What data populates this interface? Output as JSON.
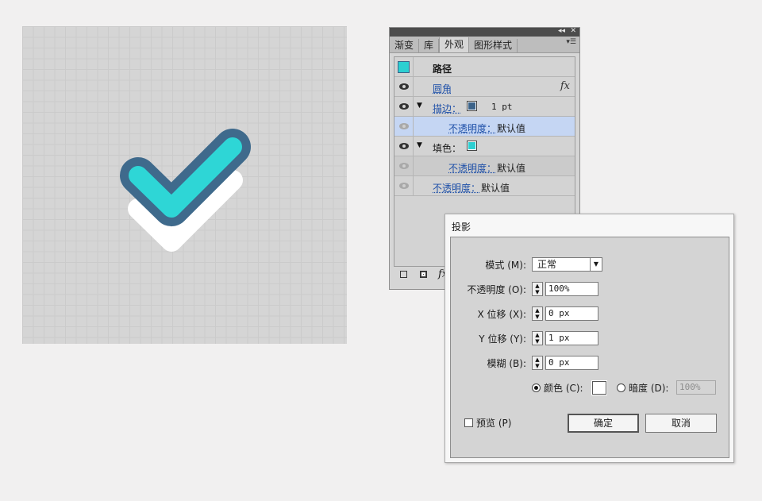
{
  "colors": {
    "check_fill": "#2ed6d6",
    "check_stroke": "#3f6a8c",
    "stroke_swatch": "#3c6389",
    "fill_swatch": "#2ccfd1"
  },
  "panel": {
    "tabs": [
      "渐变",
      "库",
      "外观",
      "图形样式"
    ],
    "active_tab": "外观",
    "header": "路径",
    "rows": {
      "effect": "圆角",
      "stroke_label": "描边：",
      "stroke_value": "1 pt",
      "stroke_opacity_label": "不透明度：",
      "stroke_opacity_value": "默认值",
      "fill_label": "填色：",
      "fill_opacity_label": "不透明度：",
      "fill_opacity_value": "默认值",
      "opacity_label": "不透明度：",
      "opacity_value": "默认值"
    },
    "fx_glyph": "fx",
    "collapse_glyph": "◂◂",
    "close_glyph": "✕",
    "menu_glyph": "▾☰"
  },
  "dialog": {
    "title": "投影",
    "mode_label": "模式 (M):",
    "mode_value": "正常",
    "opacity_label": "不透明度 (O):",
    "opacity_value": "100%",
    "x_label": "X 位移 (X):",
    "x_value": "0 px",
    "y_label": "Y 位移 (Y):",
    "y_value": "1 px",
    "blur_label": "模糊 (B):",
    "blur_value": "0 px",
    "color_label": "颜色 (C):",
    "darkness_label": "暗度 (D):",
    "darkness_value": "100%",
    "preview_label": "预览 (P)",
    "ok_label": "确定",
    "cancel_label": "取消"
  }
}
